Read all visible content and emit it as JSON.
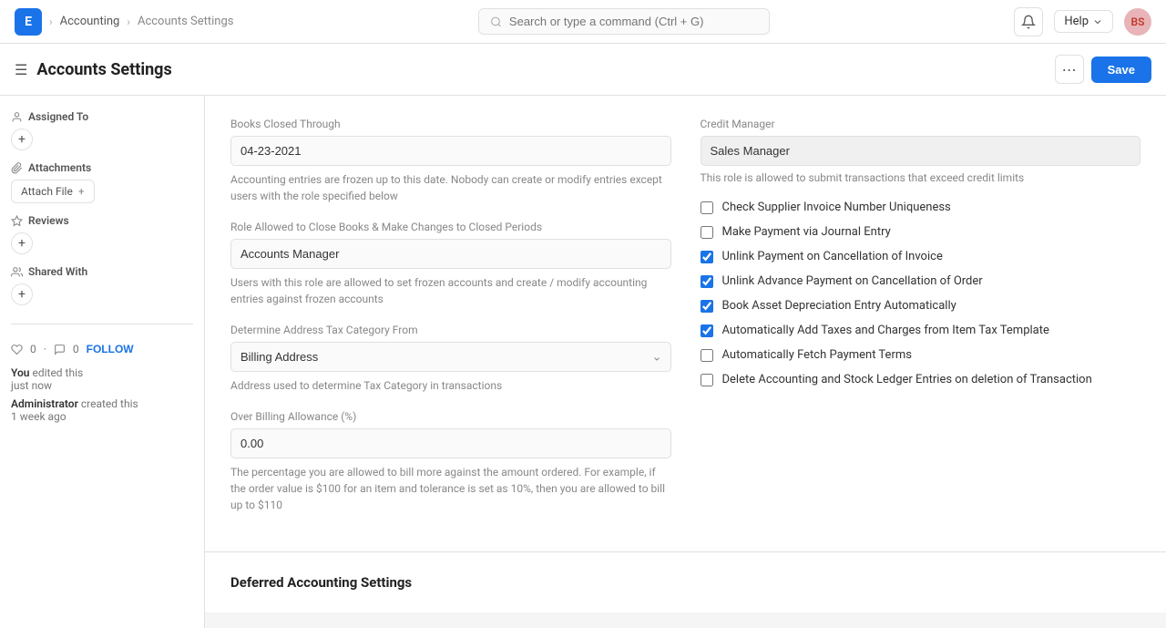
{
  "topnav": {
    "app_icon": "E",
    "breadcrumb": [
      {
        "label": "Accounting",
        "active": false
      },
      {
        "label": "Accounts Settings",
        "active": true
      }
    ],
    "search_placeholder": "Search or type a command (Ctrl + G)",
    "help_label": "Help",
    "avatar_initials": "BS"
  },
  "page_header": {
    "title": "Accounts Settings",
    "dots_label": "⋯",
    "save_label": "Save"
  },
  "sidebar": {
    "assigned_to_label": "Assigned To",
    "attachments_label": "Attachments",
    "attach_file_label": "Attach File",
    "reviews_label": "Reviews",
    "shared_with_label": "Shared With",
    "follow_label": "FOLLOW",
    "likes_count": "0",
    "comments_count": "0",
    "activity": {
      "edited_by": "You",
      "edited_action": "edited this",
      "edited_time": "just now",
      "created_by": "Administrator",
      "created_action": "created this",
      "created_time": "1 week ago"
    }
  },
  "main": {
    "books_closed_section": {
      "books_closed_through_label": "Books Closed Through",
      "books_closed_through_value": "04-23-2021",
      "books_closed_hint": "Accounting entries are frozen up to this date. Nobody can create or modify entries except users with the role specified below",
      "role_close_books_label": "Role Allowed to Close Books & Make Changes to Closed Periods",
      "role_close_books_value": "Accounts Manager",
      "role_close_books_hint": "Users with this role are allowed to set frozen accounts and create / modify accounting entries against frozen accounts",
      "determine_address_label": "Determine Address Tax Category From",
      "determine_address_value": "Billing Address",
      "determine_address_hint": "Address used to determine Tax Category in transactions",
      "over_billing_label": "Over Billing Allowance (%)",
      "over_billing_value": "0.00",
      "over_billing_hint": "The percentage you are allowed to bill more against the amount ordered. For example, if the order value is $100 for an item and tolerance is set as 10%, then you are allowed to bill up to $110"
    },
    "credit_manager_section": {
      "credit_manager_label": "Credit Manager",
      "credit_manager_value": "Sales Manager",
      "credit_manager_hint": "This role is allowed to submit transactions that exceed credit limits",
      "checkboxes": [
        {
          "id": "cb1",
          "label": "Check Supplier Invoice Number Uniqueness",
          "checked": false
        },
        {
          "id": "cb2",
          "label": "Make Payment via Journal Entry",
          "checked": false
        },
        {
          "id": "cb3",
          "label": "Unlink Payment on Cancellation of Invoice",
          "checked": true
        },
        {
          "id": "cb4",
          "label": "Unlink Advance Payment on Cancellation of Order",
          "checked": true
        },
        {
          "id": "cb5",
          "label": "Book Asset Depreciation Entry Automatically",
          "checked": true
        },
        {
          "id": "cb6",
          "label": "Automatically Add Taxes and Charges from Item Tax Template",
          "checked": true
        },
        {
          "id": "cb7",
          "label": "Automatically Fetch Payment Terms",
          "checked": false
        },
        {
          "id": "cb8",
          "label": "Delete Accounting and Stock Ledger Entries on deletion of Transaction",
          "checked": false
        }
      ]
    },
    "deferred_settings_label": "Deferred Accounting Settings"
  }
}
